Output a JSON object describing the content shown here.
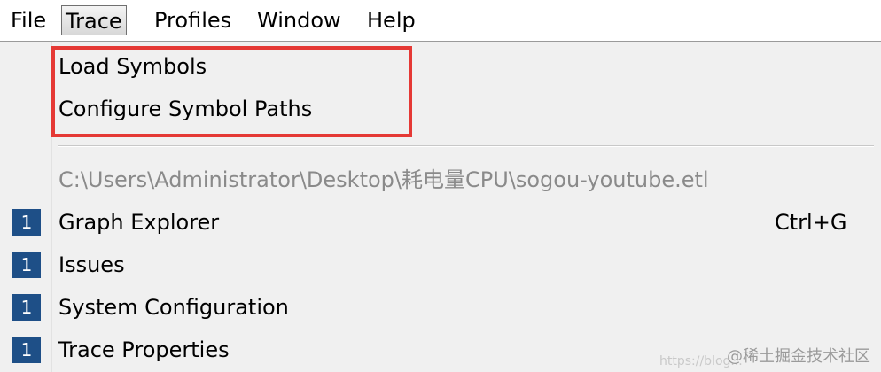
{
  "menubar": {
    "items": [
      "File",
      "Trace",
      "Profiles",
      "Window",
      "Help"
    ],
    "active": "Trace"
  },
  "trace_menu": {
    "symbols": [
      "Load Symbols",
      "Configure Symbol Paths"
    ],
    "recent_file": "C:\\Users\\Administrator\\Desktop\\耗电量CPU\\sogou-youtube.etl",
    "views": [
      {
        "badge": "1",
        "label": "Graph Explorer",
        "shortcut": "Ctrl+G"
      },
      {
        "badge": "1",
        "label": "Issues"
      },
      {
        "badge": "1",
        "label": "System Configuration"
      },
      {
        "badge": "1",
        "label": "Trace Properties"
      }
    ]
  },
  "watermark": {
    "text": "@稀土掘金技术社区",
    "faint": "https://blog..."
  },
  "colors": {
    "highlight": "#e53935",
    "badge": "#1e4f87",
    "menu_background": "#f0f0f0"
  }
}
